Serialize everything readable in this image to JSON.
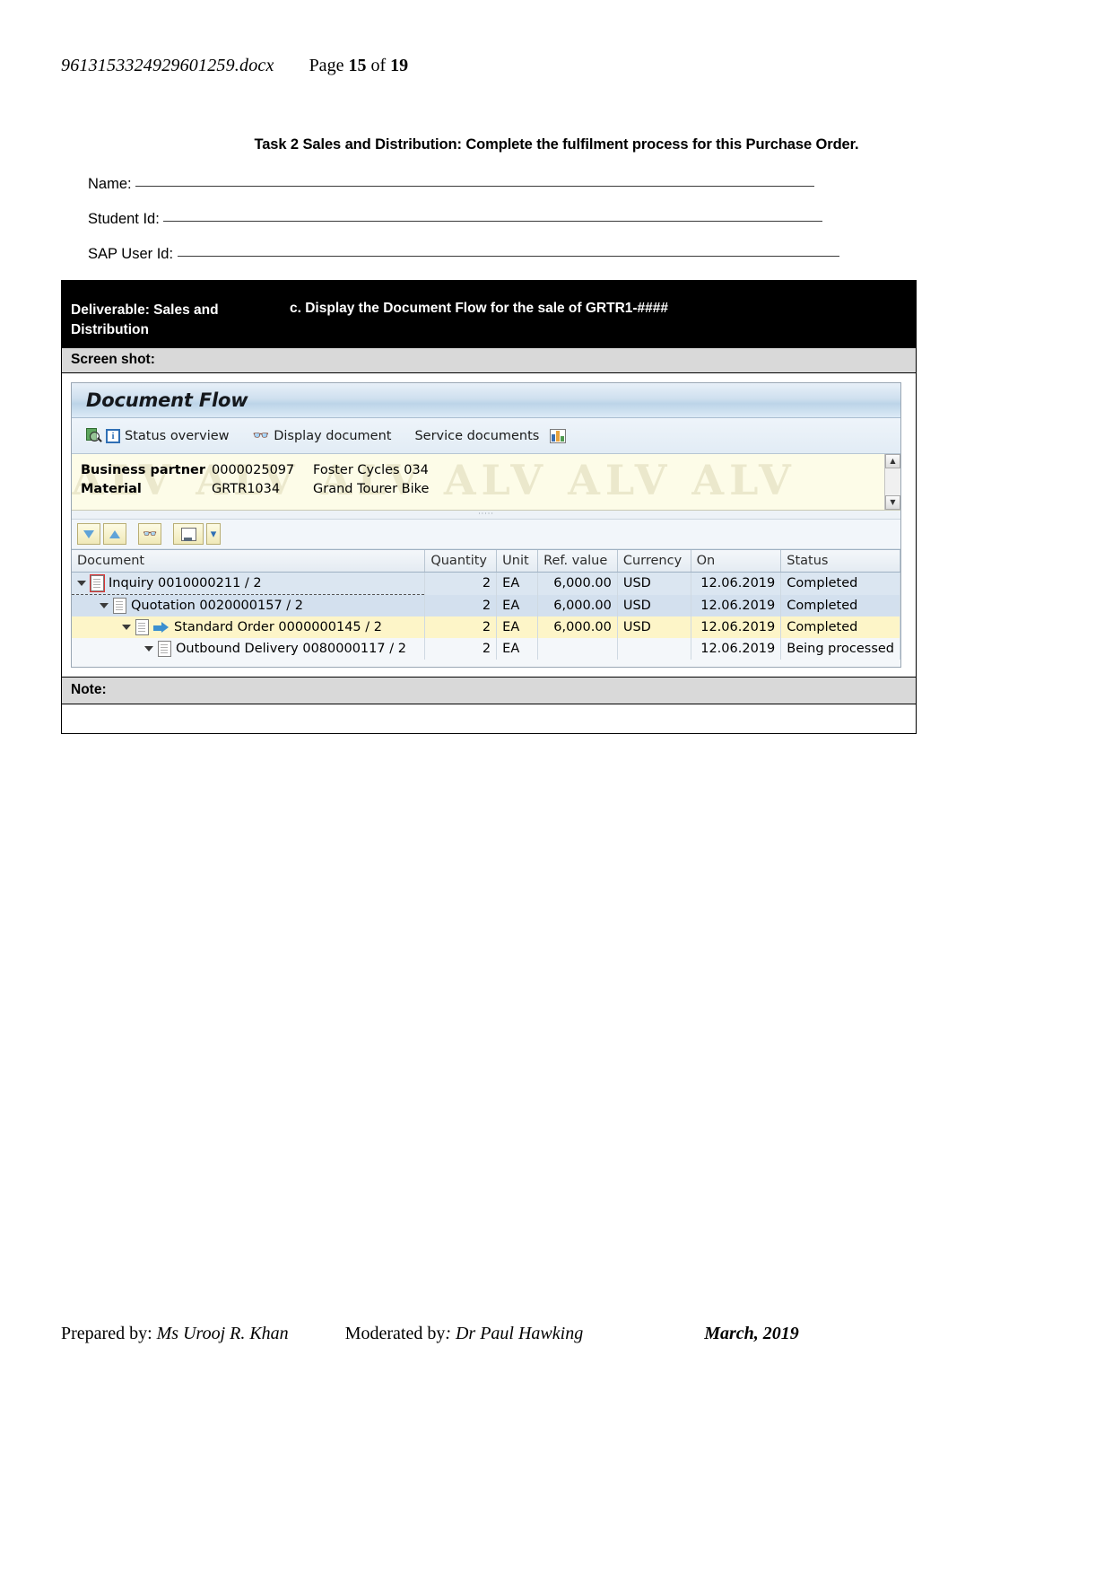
{
  "page_header": {
    "document_name": "9613153324929601259.docx",
    "page_label": "Page",
    "page_number": "15",
    "of_label": "of",
    "total_pages": "19"
  },
  "task_title": "Task 2 Sales and Distribution: Complete the fulfilment process for this Purchase Order.",
  "form_fields": [
    {
      "label": "Name:"
    },
    {
      "label": "Student Id:"
    },
    {
      "label": "SAP User Id:"
    }
  ],
  "deliverable": {
    "left_label": "Deliverable: Sales and Distribution",
    "instruction": "c. Display the Document Flow for the sale of GRTR1-####",
    "screenshot_label": "Screen shot:",
    "note_label": "Note:"
  },
  "sap": {
    "window_title": "Document Flow",
    "toolbar": [
      {
        "label": "Status overview",
        "icon": "magnifier-document-icon"
      },
      {
        "label": "Display document",
        "icon": "glasses-icon"
      },
      {
        "label": "Service documents",
        "icon": "bar-chart-icon"
      }
    ],
    "watermark_text": "ALV ALV ALV ALV ALV ALV",
    "info": [
      {
        "key": "Business partner",
        "value1": "0000025097",
        "value2": "Foster Cycles 034"
      },
      {
        "key": "Material",
        "value1": "GRTR1034",
        "value2": "Grand Tourer Bike"
      }
    ],
    "grid_toolbar": [
      {
        "name": "expand-all-button",
        "glyph": "▼"
      },
      {
        "name": "collapse-all-button",
        "glyph": "▲"
      },
      {
        "name": "find-button",
        "glyph": "⌕"
      },
      {
        "name": "print-button",
        "glyph": "⎙"
      },
      {
        "name": "print-menu-button",
        "glyph": "▾"
      }
    ],
    "columns": [
      "Document",
      "Quantity",
      "Unit",
      "Ref. value",
      "Currency",
      "On",
      "Status"
    ],
    "rows": [
      {
        "document": "Inquiry 0010000211 / 2",
        "quantity": "2",
        "unit": "EA",
        "ref_value": "6,000.00",
        "currency": "USD",
        "on": "12.06.2019",
        "status": "Completed",
        "level": 1,
        "row_style": "r-blue",
        "selected": true,
        "has_arrow": false
      },
      {
        "document": "Quotation 0020000157 / 2",
        "quantity": "2",
        "unit": "EA",
        "ref_value": "6,000.00",
        "currency": "USD",
        "on": "12.06.2019",
        "status": "Completed",
        "level": 2,
        "row_style": "r-blue2",
        "selected": false,
        "has_arrow": false
      },
      {
        "document": "Standard Order 0000000145 / 2",
        "quantity": "2",
        "unit": "EA",
        "ref_value": "6,000.00",
        "currency": "USD",
        "on": "12.06.2019",
        "status": "Completed",
        "level": 3,
        "row_style": "r-yellow",
        "selected": false,
        "has_arrow": true
      },
      {
        "document": "Outbound Delivery 0080000117 / 2",
        "quantity": "2",
        "unit": "EA",
        "ref_value": "",
        "currency": "",
        "on": "12.06.2019",
        "status": "Being processed",
        "level": 4,
        "row_style": "r-plain",
        "selected": false,
        "has_arrow": false
      }
    ]
  },
  "page_footer": {
    "prepared_by_label": "Prepared by:",
    "prepared_by_name": "Ms Urooj R. Khan",
    "moderated_by_label": "Moderated by",
    "moderated_by_name": ": Dr Paul Hawking",
    "date": "March, 2019"
  }
}
